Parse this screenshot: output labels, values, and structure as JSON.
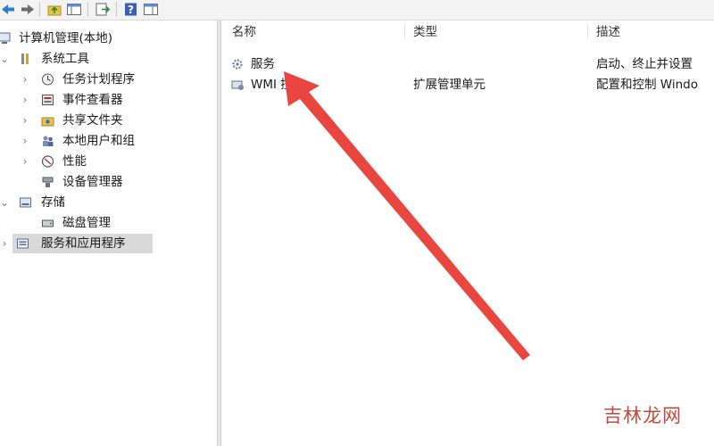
{
  "tree": {
    "root": {
      "label": "计算机管理(本地)",
      "icon": "computer-management-icon"
    },
    "items": [
      {
        "label": "系统工具",
        "icon": "tools-icon",
        "expander": "expanded"
      },
      {
        "label": "任务计划程序",
        "icon": "clock-icon",
        "expander": "collapsed"
      },
      {
        "label": "事件查看器",
        "icon": "event-viewer-icon",
        "expander": "collapsed"
      },
      {
        "label": "共享文件夹",
        "icon": "shared-folder-icon",
        "expander": "collapsed"
      },
      {
        "label": "本地用户和组",
        "icon": "users-icon",
        "expander": "collapsed"
      },
      {
        "label": "性能",
        "icon": "performance-icon",
        "expander": "collapsed"
      },
      {
        "label": "设备管理器",
        "icon": "device-manager-icon",
        "expander": "none"
      },
      {
        "label": "存储",
        "icon": "storage-icon",
        "expander": "expanded"
      },
      {
        "label": "磁盘管理",
        "icon": "disk-icon",
        "expander": "none"
      },
      {
        "label": "服务和应用程序",
        "icon": "services-apps-icon",
        "expander": "collapsed",
        "selected": true
      }
    ]
  },
  "list": {
    "columns": [
      "名称",
      "类型",
      "描述"
    ],
    "rows": [
      {
        "name": "服务",
        "type": "",
        "description": "启动、终止并设置",
        "icon": "services-gear-icon"
      },
      {
        "name": "WMI 控件",
        "type": "扩展管理单元",
        "description": "配置和控制 Windo",
        "icon": "wmi-icon"
      }
    ]
  },
  "annotation": {
    "color": "#e8463e"
  },
  "watermark": {
    "text": "吉林龙网"
  }
}
